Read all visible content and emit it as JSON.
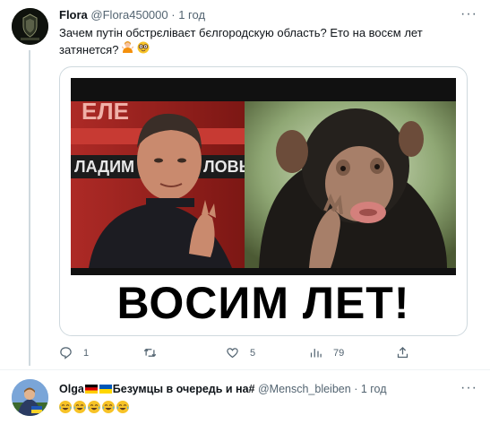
{
  "tweet": {
    "display_name": "Flora",
    "handle": "@Flora450000",
    "separator": "·",
    "time": "1 год",
    "more_label": "···",
    "text": "Зачем путін обстрєліваєт бєлгородскую область? Ето на восєм лет затянется?",
    "emojis": [
      "person-shrugging",
      "nerd-face"
    ],
    "media": {
      "caption": "ВОСИМ ЛЕТ!",
      "background_text_1": "ЕЛЕ",
      "background_text_2": "ЛАДИМ",
      "background_text_3": "ЛОВЬ"
    },
    "actions": {
      "replies": "1",
      "retweets": "",
      "likes": "5",
      "views": "79"
    }
  },
  "reply": {
    "display_name": "Olga",
    "flags": [
      "germany",
      "ukraine"
    ],
    "display_name_suffix": "Безумцы в очередь и на#",
    "handle": "@Mensch_bleiben",
    "separator": "·",
    "time": "1 год",
    "more_label": "···",
    "emoji_count": 5,
    "emoji": "tears-of-joy"
  },
  "colors": {
    "text_primary": "#0f1419",
    "text_secondary": "#536471",
    "border": "#cfd9de",
    "divider": "#eff3f4"
  }
}
